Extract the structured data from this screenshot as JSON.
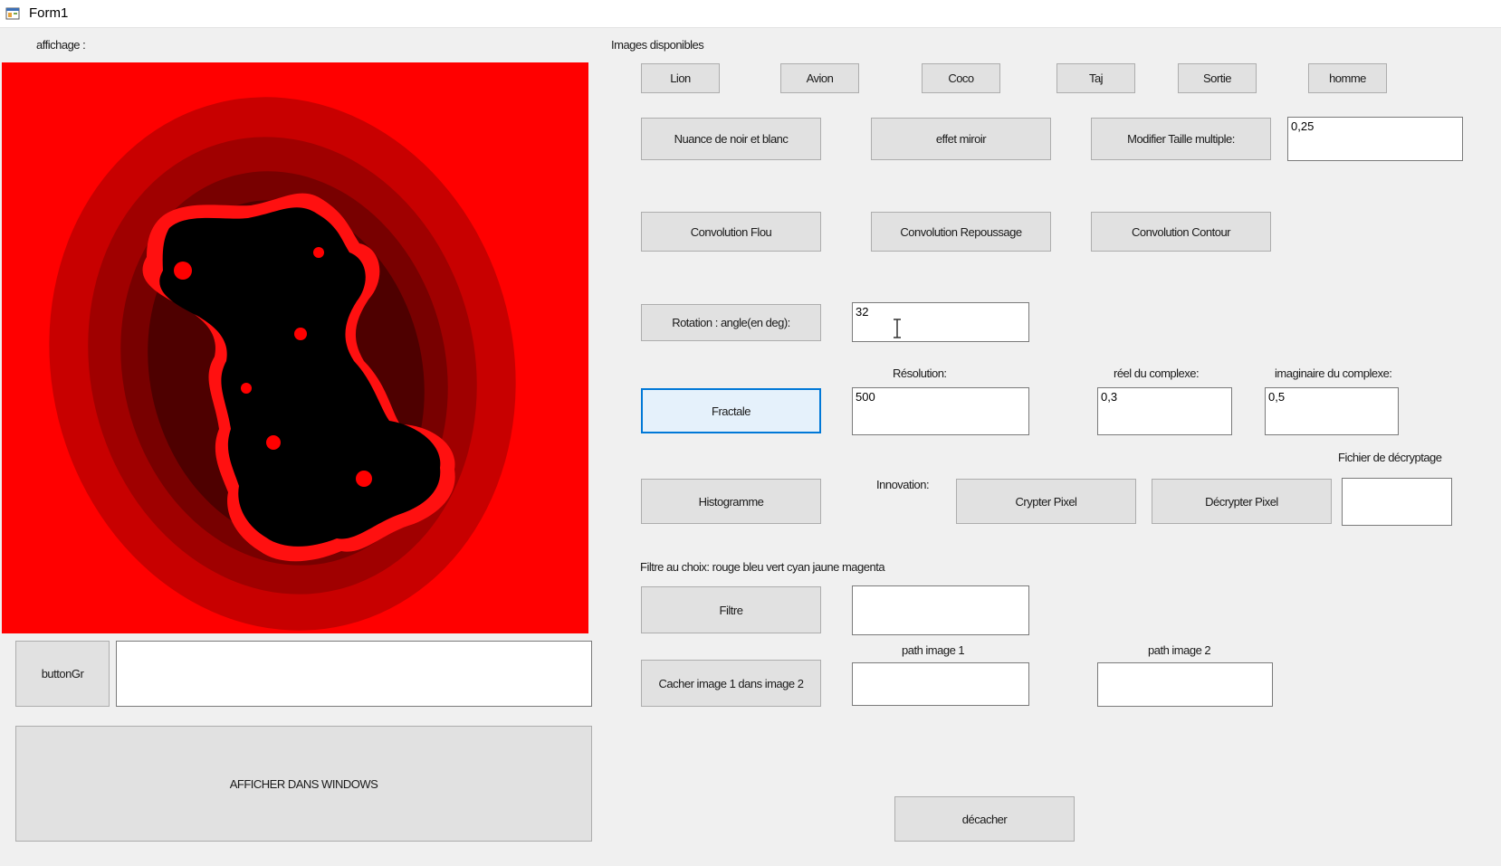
{
  "window": {
    "title": "Form1"
  },
  "labels": {
    "affichage": "affichage :",
    "images_disponibles": "Images disponibles",
    "resolution": "Résolution:",
    "reel": "réel du complexe:",
    "imaginaire": "imaginaire du complexe:",
    "fichier_decryptage": "Fichier de décryptage",
    "innovation": "Innovation:",
    "filtre_choix": "Filtre au choix: rouge bleu vert cyan jaune magenta",
    "path_image_1": "path image 1",
    "path_image_2": "path image 2"
  },
  "buttons": {
    "lion": "Lion",
    "avion": "Avion",
    "coco": "Coco",
    "taj": "Taj",
    "sortie": "Sortie",
    "homme": "homme",
    "nuance": "Nuance de noir et blanc",
    "miroir": "effet miroir",
    "modifier_taille": "Modifier Taille multiple:",
    "conv_flou": "Convolution Flou",
    "conv_repoussage": "Convolution Repoussage",
    "conv_contour": "Convolution Contour",
    "rotation": "Rotation : angle(en deg):",
    "fractale": "Fractale",
    "histogramme": "Histogramme",
    "crypter": "Crypter Pixel",
    "decrypter": "Décrypter Pixel",
    "filtre": "Filtre",
    "cacher": "Cacher image 1 dans image 2",
    "buttongr": "buttonGr",
    "afficher": "AFFICHER DANS WINDOWS",
    "decacher": "décacher"
  },
  "inputs": {
    "taille": "0,25",
    "rotation": "32",
    "resolution": "500",
    "reel": "0,3",
    "imaginaire": "0,5",
    "fichier_decryptage": "",
    "filtre": "",
    "path_image_1": "",
    "path_image_2": "",
    "buttongr_text": ""
  },
  "display": {
    "colors": {
      "background": "#ff0000",
      "band_1": "#c80000",
      "band_2": "#a00000",
      "band_3": "#780000",
      "band_4": "#4e0000",
      "fractal_core": "#000000"
    }
  },
  "icons": {
    "app": "form-app-icon",
    "cursor": "text-cursor-icon"
  }
}
